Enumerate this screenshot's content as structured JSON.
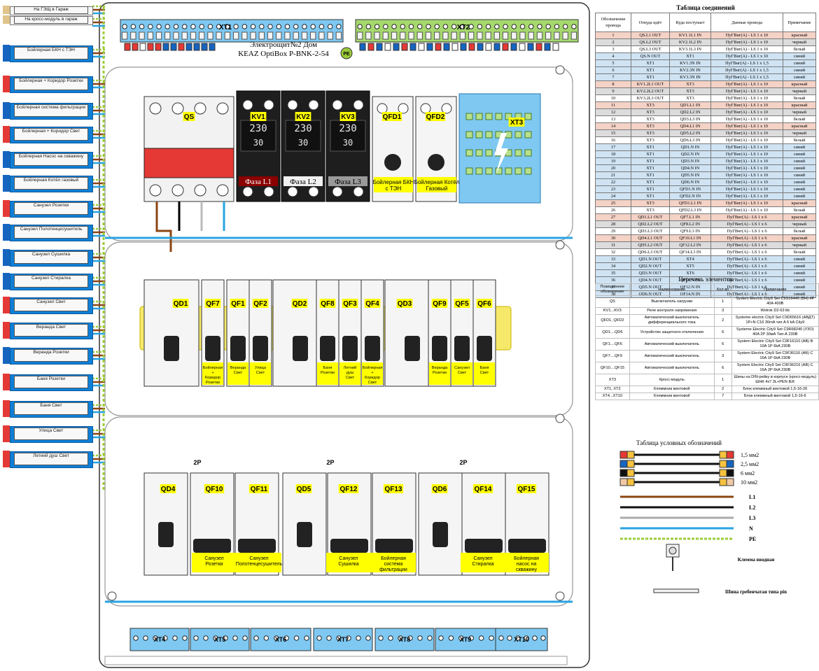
{
  "panel": {
    "title_line1": "Электрощит№2 Дом",
    "title_line2": "KEAZ OptiBox P-BNK-2-54",
    "pe_badge": "PE"
  },
  "terminal_blocks": {
    "top": [
      "XT1",
      "XT2"
    ],
    "bottom": [
      "XT4",
      "XT5",
      "XT6",
      "XT7",
      "XT8",
      "XT9",
      "XT10"
    ],
    "xt3": "XT3"
  },
  "devices": {
    "row1": [
      "QS",
      "KV1",
      "KV2",
      "KV3",
      "QFD1",
      "QFD2"
    ],
    "row1_phase_labels": [
      "Фаза L1",
      "Фаза L2",
      "Фаза L3"
    ],
    "row1_qfd_labels": [
      "Бойлерная БКН с ТЭН",
      "Бойлерная Котёл Газовый"
    ],
    "row2": [
      "QD1",
      "QF7",
      "QF1",
      "QF2",
      "QD2",
      "QF8",
      "QF3",
      "QF4",
      "QD3",
      "QF9",
      "QF5",
      "QF6"
    ],
    "row2_labels": [
      "Бойлерная + Коридор Розетки",
      "Веранда Свет",
      "Улица Свет",
      "Баня Розетки",
      "Летний душ Свет",
      "Бойлерная + Коридор Свет",
      "Веранда Розетки",
      "Санузел Свет",
      "Баня Свет"
    ],
    "row3": [
      "QD4",
      "QF10",
      "QF11",
      "QD5",
      "QF12",
      "QF13",
      "QD6",
      "QF14",
      "QF15"
    ],
    "row3_labels": [
      "Санузел Розетки",
      "Санузел Полотенцесушитель",
      "Санузел Сушилка",
      "Бойлерная система фильтрации",
      "Санузел Стиралка",
      "Бойлерная насос на скважину"
    ],
    "row3_2p": [
      "2P",
      "2P",
      "2P"
    ],
    "kv_display": [
      "230",
      "30"
    ]
  },
  "outputs": [
    "На ГЭЩ в Гараж",
    "На кросс-модуль в гараж",
    "Бойлерная БКН с ТЭН",
    "Бойлерная + Коридор Розетки",
    "Бойлерная система фильтрации",
    "Бойлерная + Коридор Свет",
    "Бойлерная Насос на скважину",
    "Бойлерная Котёл газовый",
    "Санузел Розетки",
    "Санузел Полотенцесушитель",
    "Санузел Сушилка",
    "Санузел Стиралка",
    "Санузел Свет",
    "Веранда Свет",
    "Веранда Розетки",
    "Баня Розетки",
    "Баня Свет",
    "Улица Свет",
    "Летний душ Свет"
  ],
  "output_term_colors": [
    "red",
    "red",
    "blue",
    "red",
    "blue",
    "red",
    "blue",
    "blue",
    "red",
    "blue",
    "blue",
    "blue",
    "red",
    "red",
    "blue",
    "red",
    "red",
    "red",
    "red"
  ],
  "connection_table": {
    "title": "Таблица соединений",
    "headers": [
      "Обозначение провода",
      "Откуда идёт",
      "Куда поступает",
      "Данные провода",
      "Примечание"
    ],
    "rows": [
      [
        "1",
        "QS.L1 OUT",
        "KV1.1L1 IN",
        "ПуГВнг(А) - LS 1 x 10",
        "красный"
      ],
      [
        "2",
        "QS.L2 OUT",
        "KV2.1L2 IN",
        "ПуГВнг(А) - LS 1 x 10",
        "черный"
      ],
      [
        "3",
        "QS.L3 OUT",
        "KV3.1L3 IN",
        "ПуГВнг(А) - LS 1 x 10",
        "белый"
      ],
      [
        "4",
        "QS.N OUT",
        "XT1",
        "ПуГВнг(А) - LS 1 x 10",
        "синий"
      ],
      [
        "5",
        "XT1",
        "KV1.3N IN",
        "ПуГВнг(А) - LS 1 x 1,5",
        "синий"
      ],
      [
        "6",
        "XT1",
        "KV2.3N IN",
        "ПуГВнг(А) - LS 1 x 1,5",
        "синий"
      ],
      [
        "7",
        "XT1",
        "KV3.3N IN",
        "ПуГВнг(А) - LS 1 x 1,5",
        "синий"
      ],
      [
        "8",
        "KV1.2L1 OUT",
        "XT3",
        "ПуГВнг(А) - LS 1 x 10",
        "красный"
      ],
      [
        "9",
        "KV2.2L2 OUT",
        "XT3",
        "ПуГВнг(А) - LS 1 x 10",
        "черный"
      ],
      [
        "10",
        "KV3.2L3 OUT",
        "XT3",
        "ПуГВнг(А) - LS 1 x 10",
        "белый"
      ],
      [
        "11",
        "XT3",
        "QD1.L1 IN",
        "ПуГВнг(А) - LS 1 x 10",
        "красный"
      ],
      [
        "12",
        "XT3",
        "QD2.L2 IN",
        "ПуГВнг(А) - LS 1 x 10",
        "черный"
      ],
      [
        "13",
        "XT3",
        "QD3.L3 IN",
        "ПуГВнг(А) - LS 1 x 10",
        "белый"
      ],
      [
        "14",
        "XT3",
        "QD4.L1 IN",
        "ПуГВнг(А) - LS 1 x 10",
        "красный"
      ],
      [
        "15",
        "XT3",
        "QD5.L2 IN",
        "ПуГВнг(А) - LS 1 x 10",
        "черный"
      ],
      [
        "16",
        "XT3",
        "QD6.L3 IN",
        "ПуГВнг(А) - LS 1 x 10",
        "белый"
      ],
      [
        "17",
        "XT1",
        "QD1.N IN",
        "ПуГВнг(А) - LS 1 x 10",
        "синий"
      ],
      [
        "18",
        "XT1",
        "QD2.N IN",
        "ПуГВнг(А) - LS 1 x 10",
        "синий"
      ],
      [
        "19",
        "XT1",
        "QD3.N IN",
        "ПуГВнг(А) - LS 1 x 10",
        "синий"
      ],
      [
        "20",
        "XT1",
        "QD4.N IN",
        "ПуГВнг(А) - LS 1 x 10",
        "синий"
      ],
      [
        "21",
        "XT1",
        "QD5.N IN",
        "ПуГВнг(А) - LS 1 x 10",
        "синий"
      ],
      [
        "22",
        "XT1",
        "QD6.N IN",
        "ПуГВнг(А) - LS 1 x 10",
        "синий"
      ],
      [
        "23",
        "XT1",
        "QFD1.N IN",
        "ПуГВнг(А) - LS 1 x 10",
        "синий"
      ],
      [
        "24",
        "XT1",
        "QFD2.N IN",
        "ПуГВнг(А) - LS 1 x 10",
        "синий"
      ],
      [
        "25",
        "XT3",
        "QFD1.L1 IN",
        "ПуГВнг(А) - LS 1 x 10",
        "красный"
      ],
      [
        "26",
        "XT3",
        "QFD2.L3 IN",
        "ПуГВнг(А) - LS 1 x 10",
        "белый"
      ],
      [
        "27",
        "QD1.L1 OUT",
        "QF7.L1 IN",
        "ПуГВнг(А) - LS 1 x 6",
        "красный"
      ],
      [
        "28",
        "QD2.L2 OUT",
        "QF8.L2 IN",
        "ПуГВнг(А) - LS 1 x 6",
        "черный"
      ],
      [
        "29",
        "QD3.L3 OUT",
        "QF9.L3 IN",
        "ПуГВнг(А) - LS 1 x 6",
        "белый"
      ],
      [
        "30",
        "QD4.L1 OUT",
        "QF10.L1 IN",
        "ПуГВнг(А) - LS 1 x 6",
        "красный"
      ],
      [
        "31",
        "QD5.L2 OUT",
        "QF12.L2 IN",
        "ПуГВнг(А) - LS 1 x 6",
        "черный"
      ],
      [
        "32",
        "QD6.L3 OUT",
        "QF14.L3 IN",
        "ПуГВнг(А) - LS 1 x 6",
        "белый"
      ],
      [
        "33",
        "QD1.N OUT",
        "XT4",
        "ПуГВнг(А) - LS 1 x 6",
        "синий"
      ],
      [
        "34",
        "QD2.N OUT",
        "XT5",
        "ПуГВнг(А) - LS 1 x 6",
        "синий"
      ],
      [
        "35",
        "QD3.N OUT",
        "XT6",
        "ПуГВнг(А) - LS 1 x 6",
        "синий"
      ],
      [
        "36",
        "QD4.N OUT",
        "QF10.N IN",
        "ПуГВнг(А) - LS 1 x 6",
        "синий"
      ],
      [
        "37",
        "QD5.N OUT",
        "QF12.N IN",
        "ПуГВнг(А) - LS 1 x 6",
        "синий"
      ],
      [
        "38",
        "QD6.N OUT",
        "QF14.N IN",
        "ПуГВнг(А) - LS 1 x 6",
        "синий"
      ]
    ]
  },
  "elements_table": {
    "title": "Перечень элементов",
    "headers": [
      "Позиционное обозначение",
      "Наименование",
      "Кол-во",
      "Примечание"
    ],
    "rows": [
      [
        "QS",
        "Выключатель нагрузки",
        "1",
        "System Electric City9 Set C9S16440 (ВН) 4P 40A 400В"
      ],
      [
        "KV1...KV3",
        "Реле контроля напряжения",
        "3",
        "Welrok D2-63 bk"
      ],
      [
        "QFD1, QFD2",
        "Автоматический выключатель дифференциального тока",
        "2",
        "Systeme electric City9 Set C9D65616 (АВДТ) 1P+N C16 30mA тип A 6 kA City9"
      ],
      [
        "QD1....QD6",
        "Устройство защитного отключения",
        "6",
        "Systeme Electric City9 Set C9R68240 (УЗО) 40A 2P 30мА Тип-А 230В"
      ],
      [
        "QF1....QF6",
        "Автоматический выключатель",
        "6",
        "System Electric City9 Set C9F16110 (АВ) В 10А 1P 6kA 230В"
      ],
      [
        "QF7....QF9",
        "Автоматический выключатель",
        "3",
        "System Electric City9 Set C9F36116 (АВ) С 16А 1P 6kA 230В"
      ],
      [
        "QF10....QF15",
        "Автоматический выключатель",
        "6",
        "System Electric City9 Set C9F36216 (АВ) С 16А 2P 6kA 230В"
      ],
      [
        "XT3",
        "Кросс-модуль",
        "1",
        "Шины на DIN-рейку в корпусе (кросс-модуль) ШНК 4x7 3L+PEN IEK"
      ],
      [
        "XT1, XT2",
        "Клеммник винтовой",
        "2",
        "Блок клеммный винтовой 1,5-16-26"
      ],
      [
        "XT4...XT10",
        "Клеммник винтовой",
        "7",
        "Блок клеммный винтовой 1,5-16-6"
      ]
    ]
  },
  "legend": {
    "title": "Таблица условных обозначений",
    "wires": [
      "1,5 мм2",
      "2,5 мм2",
      "6 мм2",
      "10 мм2"
    ],
    "lines": [
      "L1",
      "L2",
      "L3",
      "N",
      "PE"
    ],
    "clamp": "Клемма вводная",
    "comb": "Шина гребенчатая типа pin"
  }
}
